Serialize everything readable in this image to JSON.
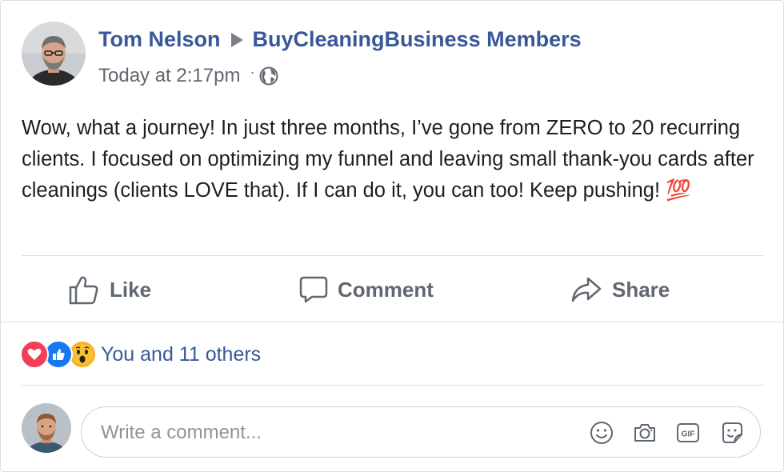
{
  "post": {
    "author": "Tom Nelson",
    "group": "BuyCleaningBusiness Members",
    "timestamp": "Today at 2:17pm",
    "separator": "·",
    "privacy_icon": "globe-icon",
    "text": "Wow, what a journey! In just three months, I’ve gone from ZERO to 20 recurring clients. I focused on optimizing my funnel and leaving small thank-you cards after cleanings (clients LOVE that). If I can do it, you can too! Keep pushing! 💯"
  },
  "actions": {
    "like_label": "Like",
    "comment_label": "Comment",
    "share_label": "Share"
  },
  "reactions": {
    "types": [
      "heart",
      "like",
      "wow"
    ],
    "summary": "You and 11 others"
  },
  "comment_box": {
    "placeholder": "Write a comment...",
    "icons": [
      "emoji-icon",
      "camera-icon",
      "gif-icon",
      "sticker-icon"
    ],
    "gif_label": "GIF"
  },
  "colors": {
    "link": "#385898",
    "text": "#1c1e21",
    "secondary": "#606770",
    "heart": "#f33e58",
    "like": "#1877f2",
    "wow": "#f7b125"
  }
}
